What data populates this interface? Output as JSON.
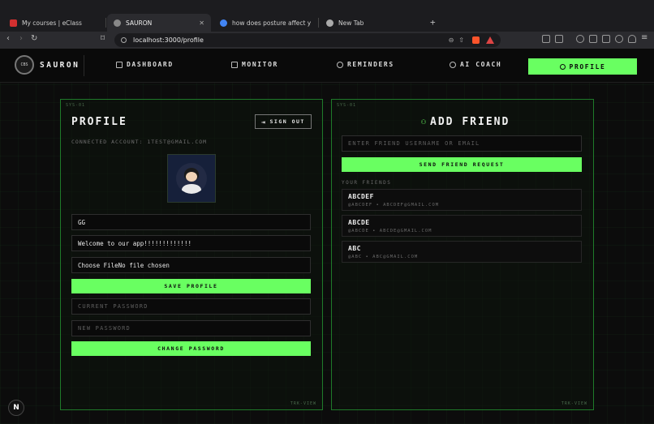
{
  "browser": {
    "tabs": [
      {
        "title": "My courses | eClass",
        "color": "#d33030"
      },
      {
        "title": "SAURON",
        "color": "#888888"
      },
      {
        "title": "how does posture affect your heal",
        "color": "#4285f4"
      },
      {
        "title": "New Tab",
        "color": "#aaaaaa"
      }
    ],
    "new_tab_symbol": "+",
    "url": "localhost:3000/profile"
  },
  "nav": {
    "logo_text": "CBS",
    "brand": "SAURON",
    "items": [
      "DASHBOARD",
      "MONITOR",
      "REMINDERS",
      "AI COACH"
    ],
    "active": "PROFILE"
  },
  "profile_panel": {
    "sys_label": "SYS-01",
    "title": "PROFILE",
    "sign_out": "SIGN OUT",
    "connected": "CONNECTED ACCOUNT: 1TEST@GMAIL.COM",
    "name_value": "GG",
    "bio_value": "Welcome to our app!!!!!!!!!!!!!",
    "file_button": "Choose File",
    "file_status": "No file chosen",
    "save_button": "SAVE PROFILE",
    "current_password_placeholder": "CURRENT PASSWORD",
    "new_password_placeholder": "NEW PASSWORD",
    "change_button": "CHANGE PASSWORD",
    "trk_label": "TRK-VIEW"
  },
  "friend_panel": {
    "sys_label": "SYS-01",
    "title": "ADD FRIEND",
    "input_placeholder": "ENTER FRIEND USERNAME OR EMAIL",
    "send_button": "SEND FRIEND REQUEST",
    "your_friends": "YOUR FRIENDS",
    "friends": [
      {
        "name": "ABCDEF",
        "sub": "@ABCDEF • ABCDEF@GMAIL.COM"
      },
      {
        "name": "ABCDE",
        "sub": "@ABCDE • ABCDE@GMAIL.COM"
      },
      {
        "name": "ABC",
        "sub": "@ABC • ABC@GMAIL.COM"
      }
    ],
    "trk_label": "TRK-VIEW"
  },
  "dev_badge": "N",
  "colors": {
    "accent": "#69ff61",
    "panel_border": "#1f7a2a",
    "background": "#0c0c0c"
  }
}
